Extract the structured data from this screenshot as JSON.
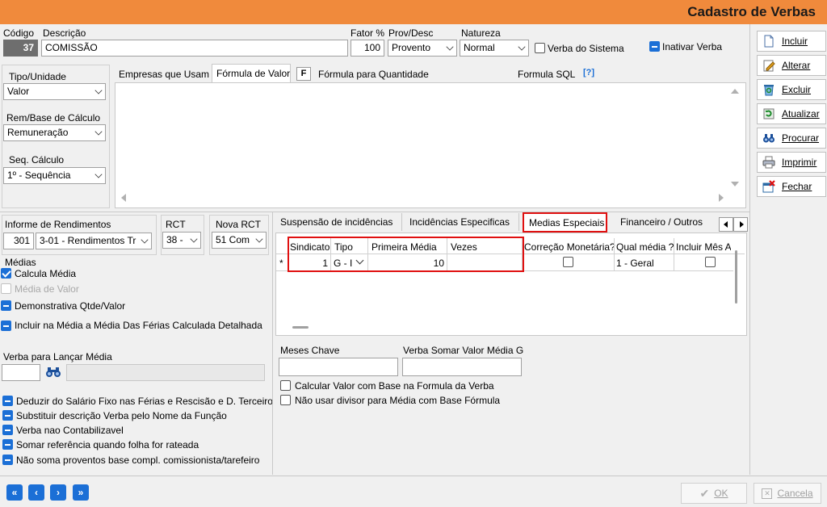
{
  "window": {
    "title": "Cadastro de Verbas"
  },
  "header": {
    "codigo_label": "Código",
    "codigo_value": "37",
    "descricao_label": "Descrição",
    "descricao_value": "COMISSÃO",
    "fator_label": "Fator %",
    "fator_value": "100",
    "provdesc_label": "Prov/Desc",
    "provdesc_value": "Provento",
    "natureza_label": "Natureza",
    "natureza_value": "Normal",
    "verba_sistema_label": "Verba do Sistema",
    "inativar_label": "Inativar Verba"
  },
  "left_top": {
    "tipo_unidade_label": "Tipo/Unidade",
    "tipo_unidade_value": "Valor",
    "rem_base_label": "Rem/Base de Cálculo",
    "rem_base_value": "Remuneração",
    "seq_calculo_label": "Seq. Cálculo",
    "seq_calculo_value": "1º - Sequência"
  },
  "formula_tabs": {
    "empresas": "Empresas que Usam",
    "formula_valor": "Fórmula de Valor",
    "f_button": "F",
    "formula_quantidade": "Fórmula para Quantidade",
    "formula_sql": "Formula SQL",
    "help_button": "[?]"
  },
  "informe": {
    "label": "Informe de Rendimentos",
    "code": "301",
    "value": "3-01 - Rendimentos Tr",
    "rct_label": "RCT",
    "rct_value": "38 -",
    "nova_rct_label": "Nova RCT",
    "nova_rct_value": "51 Com"
  },
  "medias": {
    "label": "Médias",
    "items": [
      {
        "label": "Calcula Média",
        "state": "checked"
      },
      {
        "label": "Média de Valor",
        "state": "disabled"
      },
      {
        "label": "Demonstrativa Qtde/Valor",
        "state": "dash"
      },
      {
        "label": "Incluir na Média a Média Das Férias Calculada Detalhada",
        "state": "dash"
      }
    ],
    "verba_lancar_label": "Verba para Lançar Média"
  },
  "bottom_options": [
    "Deduzir do Salário Fixo nas  Férias e Rescisão e D. Terceiro",
    "Substituir descrição Verba pelo Nome da Função",
    "Verba nao Contabilizavel",
    "Somar referência quando folha for rateada",
    "Não soma proventos base compl. comissionista/tarefeiro"
  ],
  "lower_tabs": {
    "suspensao": "Suspensão de incidências",
    "incidencias": "Incidências Especificas",
    "medias_especiais": "Medias Especiais",
    "financeiro": "Financeiro / Outros"
  },
  "grid": {
    "headers": [
      "Sindicato",
      "Tipo",
      "Primeira Média",
      "Vezes",
      "Correção Monetária?",
      "Qual média ?",
      "Incluir Mês A"
    ],
    "row": {
      "marker": "*",
      "sindicato": "1",
      "tipo": "G - I",
      "primeira_media": "10",
      "vezes": "",
      "qual_media": "1 - Geral"
    }
  },
  "meses": {
    "meses_chave_label": "Meses Chave",
    "verba_somar_label": "Verba Somar Valor Média G",
    "calc_formula_label": "Calcular Valor com Base na Formula da Verba",
    "nao_usar_divisor_label": "Não usar divisor para Média com Base Fórmula"
  },
  "side_buttons": [
    {
      "label": "Incluir",
      "icon": "document-icon"
    },
    {
      "label": "Alterar",
      "icon": "pencil-icon"
    },
    {
      "label": "Excluir",
      "icon": "recycle-icon"
    },
    {
      "label": "Atualizar",
      "icon": "refresh-icon"
    },
    {
      "label": "Procurar",
      "icon": "binoculars-icon"
    },
    {
      "label": "Imprimir",
      "icon": "printer-icon"
    },
    {
      "label": "Fechar",
      "icon": "close-window-icon"
    }
  ],
  "footer": {
    "nav": [
      "«",
      "‹",
      "›",
      "»"
    ],
    "ok_label": "OK",
    "cancel_label": "Cancela"
  },
  "colors": {
    "title_bar": "#f08a3c",
    "accent": "#1b6fd6",
    "highlight": "#e01010"
  }
}
